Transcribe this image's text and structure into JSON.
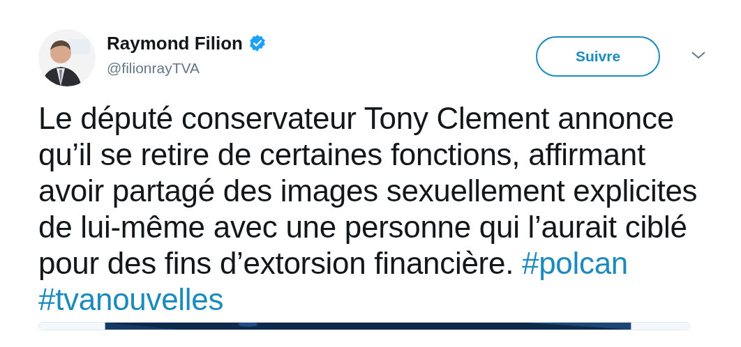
{
  "author": {
    "name": "Raymond Filion",
    "verified": true,
    "handle": "@filionrayTVA"
  },
  "follow_button": {
    "label": "Suivre"
  },
  "tweet": {
    "text": "Le député conservateur Tony Clement annonce qu’il se retire de certaines fonctions, affirmant avoir partagé des images sexuellement explicites de lui-même avec une personne qui l’aurait ciblé pour des fins d’extorsion financière.",
    "hashtags": [
      "#polcan",
      "#tvanouvelles"
    ]
  }
}
